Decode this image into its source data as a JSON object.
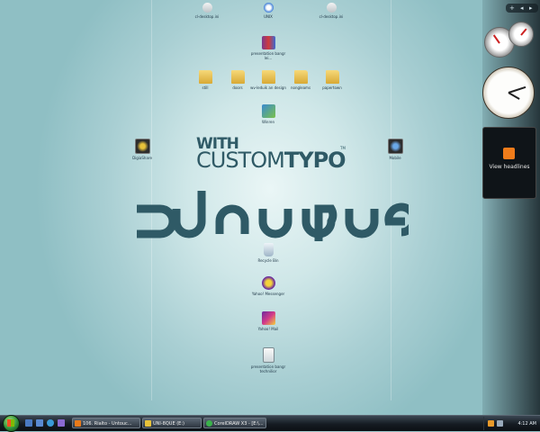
{
  "desktop_icons": {
    "top_left": {
      "label": "cl-desktop.ini"
    },
    "top_center": {
      "label": "UNIX"
    },
    "top_right": {
      "label": "cl-desktop.ini"
    },
    "archive": {
      "label": "presentation bangr lei..."
    },
    "folders": [
      {
        "label": "still"
      },
      {
        "label": "doors"
      },
      {
        "label": "wv-leduik an design"
      },
      {
        "label": "nongleams"
      },
      {
        "label": "papertown"
      }
    ],
    "app_mid": {
      "label": "Winren"
    },
    "left_cam": {
      "label": "DigiaShare"
    },
    "right_cam": {
      "label": "Mobile"
    },
    "recycle": {
      "label": "Recycle Bin"
    },
    "yahoo_messenger": {
      "label": "Yahoo! Messenger"
    },
    "yahoo_mail": {
      "label": "Yahoo! Mail"
    },
    "doc": {
      "label": "presentation bangr technilior"
    }
  },
  "wallpaper": {
    "with": "WITH",
    "custom": "CUSTOM",
    "typo": "TYPO",
    "tm": "TM",
    "logo_word": "unique"
  },
  "sidebar": {
    "top_controls": [
      "+",
      "◂",
      "▸"
    ],
    "feed_text": "View headlines"
  },
  "taskbar": {
    "tasks": [
      {
        "label": "106. Rialto - Untouc..."
      },
      {
        "label": "UNI-8QUE (E:)"
      },
      {
        "label": "CorelDRAW X3 - [E:\\..."
      }
    ],
    "time": "4:12 AM"
  },
  "colors": {
    "wallpaper_center": "#eaf6f6",
    "wallpaper_edge": "#8fbfc4",
    "logo": "#2f5a66",
    "taskbar": "#151b22",
    "rss": "#f07c1a"
  }
}
